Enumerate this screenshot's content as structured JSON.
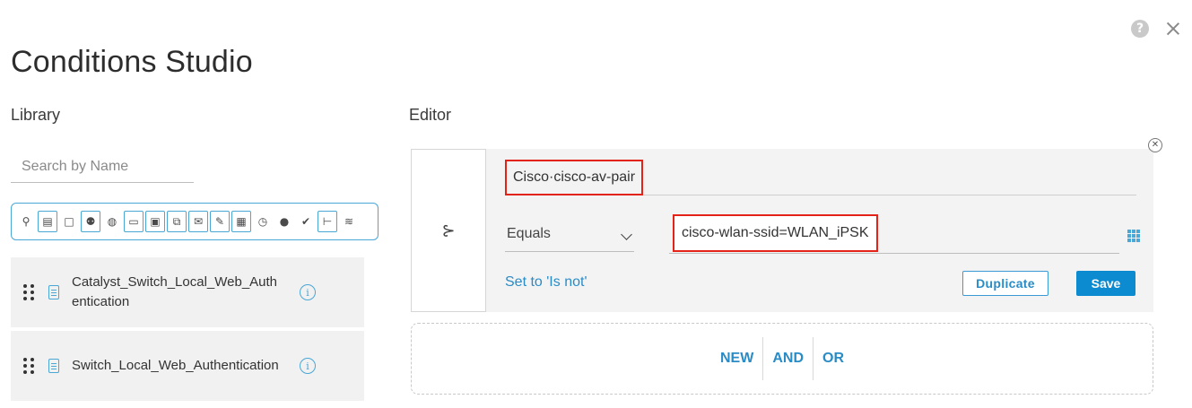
{
  "window": {
    "title": "Conditions Studio"
  },
  "library": {
    "label": "Library",
    "search_placeholder": "Search by Name",
    "filter_icons": [
      "location-icon",
      "device-icon",
      "square-icon",
      "group-icon",
      "globe-icon",
      "workstation-icon",
      "monitor-icon",
      "network-icon",
      "mail-icon",
      "edit-icon",
      "calendar-icon",
      "clock-icon",
      "user-icon",
      "check-badge-icon",
      "tree-icon",
      "wifi-icon"
    ],
    "items": [
      {
        "name": "Catalyst_Switch_Local_Web_Authentication"
      },
      {
        "name": "Switch_Local_Web_Authentication"
      }
    ]
  },
  "editor": {
    "label": "Editor",
    "attribute": "Cisco·cisco-av-pair",
    "operator": "Equals",
    "value": "cisco-wlan-ssid=WLAN_iPSK",
    "set_not_label": "Set to 'Is not'",
    "duplicate_label": "Duplicate",
    "save_label": "Save",
    "logic_new": "NEW",
    "logic_and": "AND",
    "logic_or": "OR"
  },
  "colors": {
    "accent": "#0d8bd1",
    "highlight_border": "#e2231a"
  }
}
